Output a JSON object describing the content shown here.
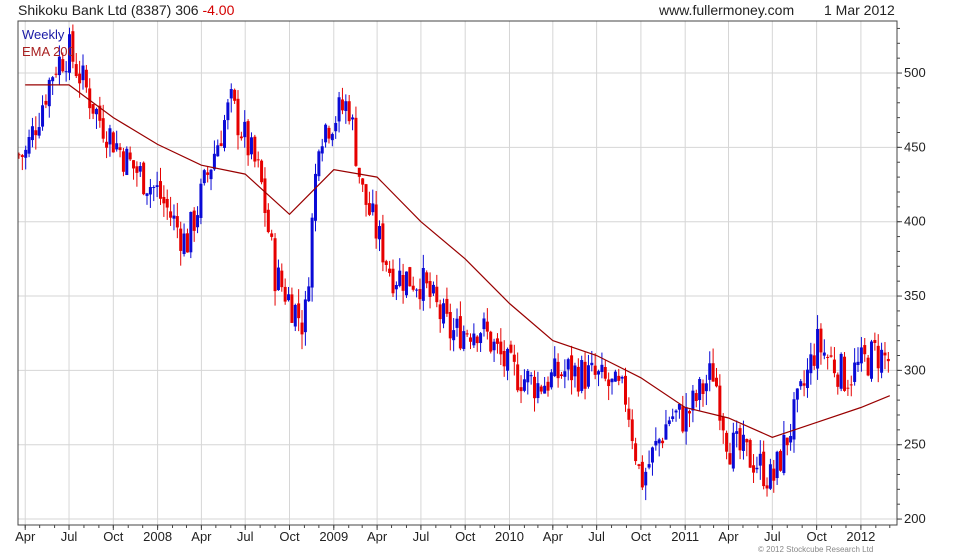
{
  "header": {
    "security": "Shikoku Bank Ltd (8387)",
    "price": "306",
    "change": "-4.00",
    "website": "www.fullermoney.com",
    "date": "1 Mar 2012"
  },
  "copyright": "© 2012 Stockcube Research Ltd",
  "colors": {
    "up": "#0a0ad6",
    "down": "#e60000",
    "ema": "#990000",
    "grid": "#d6d6d6"
  },
  "chart_data": {
    "type": "line",
    "title": "",
    "interval_label": "Weekly",
    "series": [
      {
        "name": "EMA 200",
        "x": [
          "2007-04",
          "2007-07",
          "2007-10",
          "2008-01",
          "2008-04",
          "2008-07",
          "2008-10",
          "2009-01",
          "2009-04",
          "2009-07",
          "2009-10",
          "2010-01",
          "2010-04",
          "2010-07",
          "2010-10",
          "2011-01",
          "2011-04",
          "2011-07",
          "2011-10",
          "2012-01",
          "2012-03"
        ],
        "values": [
          492,
          492,
          470,
          452,
          438,
          432,
          405,
          435,
          430,
          400,
          375,
          345,
          320,
          310,
          295,
          275,
          268,
          255,
          265,
          275,
          283
        ]
      },
      {
        "name": "Weekly close (approx.)",
        "x": [
          "2007-04",
          "2007-06",
          "2007-07",
          "2007-09",
          "2007-11",
          "2008-01",
          "2008-03",
          "2008-05",
          "2008-06",
          "2008-08",
          "2008-09",
          "2008-11",
          "2008-12",
          "2009-02",
          "2009-03",
          "2009-05",
          "2009-07",
          "2009-09",
          "2009-11",
          "2010-01",
          "2010-03",
          "2010-05",
          "2010-07",
          "2010-09",
          "2010-10",
          "2010-12",
          "2011-01",
          "2011-03",
          "2011-04",
          "2011-06",
          "2011-07",
          "2011-09",
          "2011-10",
          "2011-12",
          "2012-02",
          "2012-03"
        ],
        "values": [
          445,
          505,
          515,
          470,
          440,
          420,
          385,
          450,
          480,
          430,
          365,
          330,
          460,
          480,
          420,
          365,
          360,
          325,
          330,
          300,
          290,
          300,
          295,
          282,
          225,
          270,
          268,
          300,
          250,
          238,
          225,
          285,
          318,
          295,
          312,
          306
        ]
      }
    ],
    "xlim": [
      "2007-03-17",
      "2012-03-16"
    ],
    "ylim": [
      196,
      535
    ],
    "x_tick_labels": [
      "Apr",
      "Jul",
      "Oct",
      "2008",
      "Apr",
      "Jul",
      "Oct",
      "2009",
      "Apr",
      "Jul",
      "Oct",
      "2010",
      "Apr",
      "Jul",
      "Oct",
      "2011",
      "Apr",
      "Jul",
      "Oct",
      "2012"
    ],
    "x_tick_dates": [
      "2007-04",
      "2007-07",
      "2007-10",
      "2008-01",
      "2008-04",
      "2008-07",
      "2008-10",
      "2009-01",
      "2009-04",
      "2009-07",
      "2009-10",
      "2010-01",
      "2010-04",
      "2010-07",
      "2010-10",
      "2011-01",
      "2011-04",
      "2011-07",
      "2011-10",
      "2012-01"
    ],
    "y_ticks": [
      200,
      250,
      300,
      350,
      400,
      450,
      500
    ],
    "grid": true,
    "legend_position": "top-left"
  }
}
